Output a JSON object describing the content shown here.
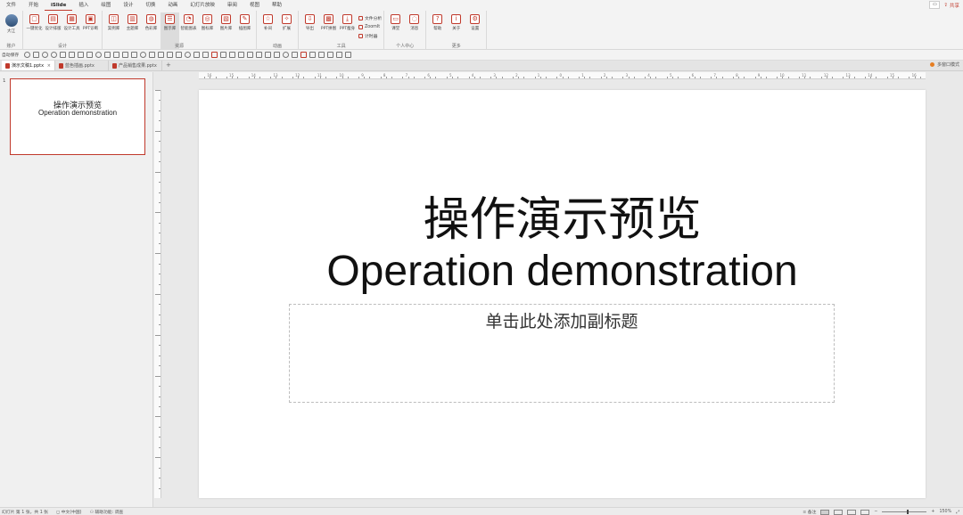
{
  "menu": {
    "items": [
      "文件",
      "开始",
      "iSlide",
      "插入",
      "绘图",
      "设计",
      "切换",
      "动画",
      "幻灯片放映",
      "审阅",
      "视图",
      "帮助"
    ],
    "active": "iSlide",
    "share_label": "共享"
  },
  "ribbon": {
    "account": {
      "user_label": "大江",
      "group_label": "账户"
    },
    "design": {
      "buttons": [
        "一键优化",
        "设计排版",
        "设计工具",
        "PPT诊断"
      ],
      "group_label": "设计"
    },
    "resources": {
      "buttons": [
        "案例库",
        "主题库",
        "色彩库",
        "图示库",
        "智能图表",
        "图标库",
        "图片库",
        "插图库"
      ],
      "group_label": "资源"
    },
    "animation": {
      "buttons": [
        "补间",
        "扩展"
      ],
      "group_label": "动画"
    },
    "tools": {
      "buttons": [
        "导出",
        "PPT拼图",
        "PPT瘦身"
      ],
      "small_items": [
        "文件分析",
        "ZoomIt",
        "计时器"
      ],
      "group_label": "工具"
    },
    "personal": {
      "buttons": [
        "课堂",
        "消息"
      ],
      "group_label": "个人中心"
    },
    "more": {
      "buttons": [
        "帮助",
        "关于",
        "设置"
      ],
      "group_label": "更多"
    }
  },
  "quickbar": {
    "autosave_label": "自动保存"
  },
  "tabs": [
    {
      "label": "演示文稿1.pptx",
      "active": true
    },
    {
      "label": "蓝色插画.pptx",
      "active": false
    },
    {
      "label": "产品销售成果.pptx",
      "active": false
    }
  ],
  "multi_window_label": "多窗口模式",
  "thumbnail": {
    "number": "1",
    "title_cn": "操作演示预览",
    "title_en": "Operation demonstration"
  },
  "slide": {
    "title_cn": "操作演示预览",
    "title_en": "Operation demonstration",
    "subtitle_placeholder": "单击此处添加副标题"
  },
  "ruler": {
    "h_labels": [
      "16",
      "15",
      "14",
      "13",
      "12",
      "11",
      "10",
      "9",
      "8",
      "7",
      "6",
      "5",
      "4",
      "3",
      "2",
      "1",
      "0",
      "1",
      "2",
      "3",
      "4",
      "5",
      "6",
      "7",
      "8",
      "9",
      "10",
      "11",
      "12",
      "13",
      "14",
      "15",
      "16"
    ]
  },
  "status": {
    "slide_info": "幻灯片 第 1 张，共 1 张",
    "language": "中文(中国)",
    "accessibility": "辅助功能: 调查",
    "notes_label": "备注",
    "zoom": "150%"
  },
  "colors": {
    "accent": "#c0392b"
  }
}
